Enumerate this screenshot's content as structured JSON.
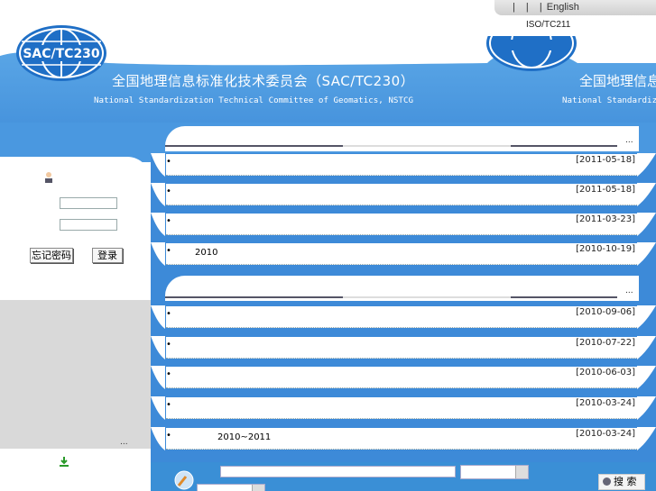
{
  "top": {
    "sep1": "|",
    "sep2": "|",
    "sep3": "|",
    "english": "English",
    "iso": "ISO/TC211"
  },
  "logo": {
    "text": "SAC/TC230"
  },
  "banner": {
    "title": "全国地理信息标准化技术委员会（SAC/TC230）",
    "subtitle": "National Standardization Technical Committee of Geomatics, NSTCG",
    "title_repeat": "全国地理信息",
    "subtitle_repeat": "National Standardiz"
  },
  "login": {
    "forgot_label": "忘记密码",
    "login_label": "登录"
  },
  "sections": [
    {
      "more": "...",
      "rows": [
        {
          "bullet": "•",
          "title": "",
          "date": "[2011-05-18]"
        },
        {
          "bullet": "•",
          "title": "",
          "date": "[2011-05-18]"
        },
        {
          "bullet": "•",
          "title": "",
          "date": "[2011-03-23]"
        },
        {
          "bullet": "•",
          "title": "2010",
          "date": "[2010-10-19]"
        }
      ]
    },
    {
      "more": "...",
      "rows": [
        {
          "bullet": "•",
          "title": "",
          "date": "[2010-09-06]"
        },
        {
          "bullet": "•",
          "title": "",
          "date": "[2010-07-22]"
        },
        {
          "bullet": "•",
          "title": "",
          "date": "[2010-06-03]"
        },
        {
          "bullet": "•",
          "title": "",
          "date": "[2010-03-24]"
        },
        {
          "bullet": "•",
          "title": "2010~2011",
          "date": "[2010-03-24]"
        }
      ]
    }
  ],
  "left": {
    "more": "..."
  },
  "search": {
    "button_label": "搜 索",
    "input_value": ""
  },
  "colors": {
    "banner_blue": "#4a9be0",
    "deep_blue": "#1f6fc6",
    "gray_panel": "#d9d9d9"
  }
}
